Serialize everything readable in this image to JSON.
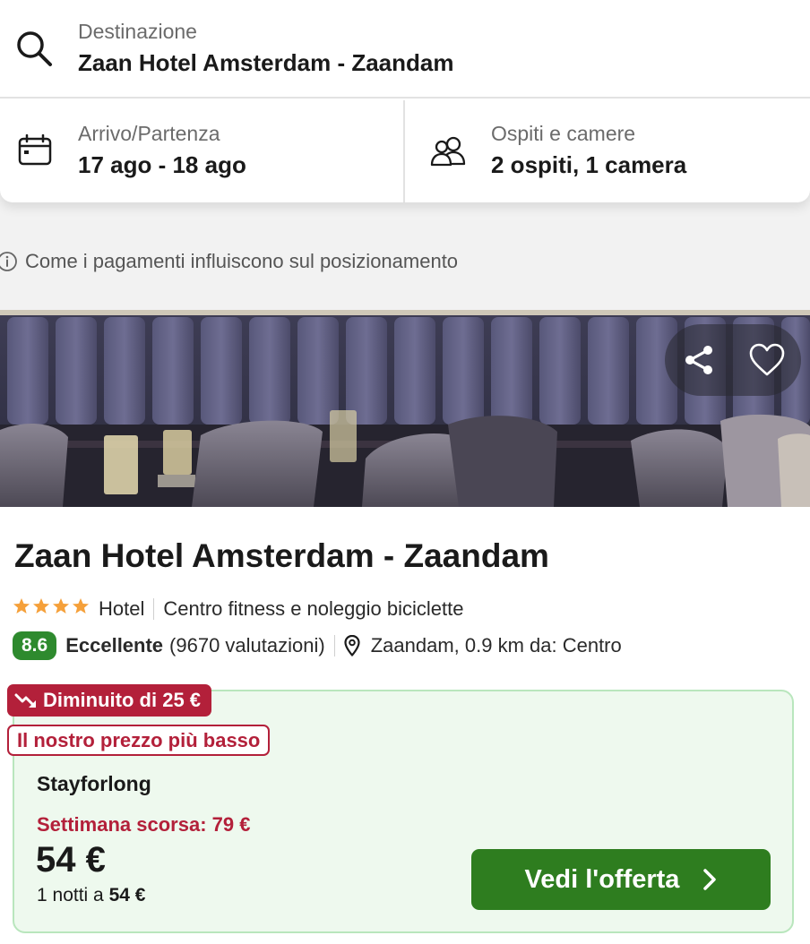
{
  "search": {
    "destination_label": "Destinazione",
    "destination_value": "Zaan Hotel Amsterdam - Zaandam",
    "dates_label": "Arrivo/Partenza",
    "dates_value": "17 ago - 18 ago",
    "guests_label": "Ospiti e camere",
    "guests_value": "2 ospiti, 1 camera"
  },
  "info": {
    "text": "Come i pagamenti influiscono sul posizionamento",
    "icon": "info-icon"
  },
  "hotel": {
    "name": "Zaan Hotel Amsterdam - Zaandam",
    "stars": 4,
    "type": "Hotel",
    "amenities": "Centro fitness e noleggio biciclette",
    "rating_score": "8.6",
    "rating_word": "Eccellente",
    "rating_count": "(9670 valutazioni)",
    "location": "Zaandam, 0.9 km da: Centro"
  },
  "image_actions": {
    "share_icon": "share-icon",
    "favorite_icon": "heart-icon"
  },
  "deal": {
    "drop_badge": "Diminuito di 25 €",
    "lowest_badge": "Il nostro prezzo più basso",
    "provider": "Stayforlong",
    "last_week": "Settimana scorsa: 79 €",
    "price": "54 €",
    "nights_prefix": "1 notti a",
    "nights_price": "54 €",
    "cta_label": "Vedi l'offerta"
  },
  "colors": {
    "accent_green": "#2e7d1f",
    "rating_green": "#2e8a2e",
    "deal_red": "#b3203a",
    "star_orange": "#f5a03a",
    "deal_bg": "#eef9ee"
  }
}
